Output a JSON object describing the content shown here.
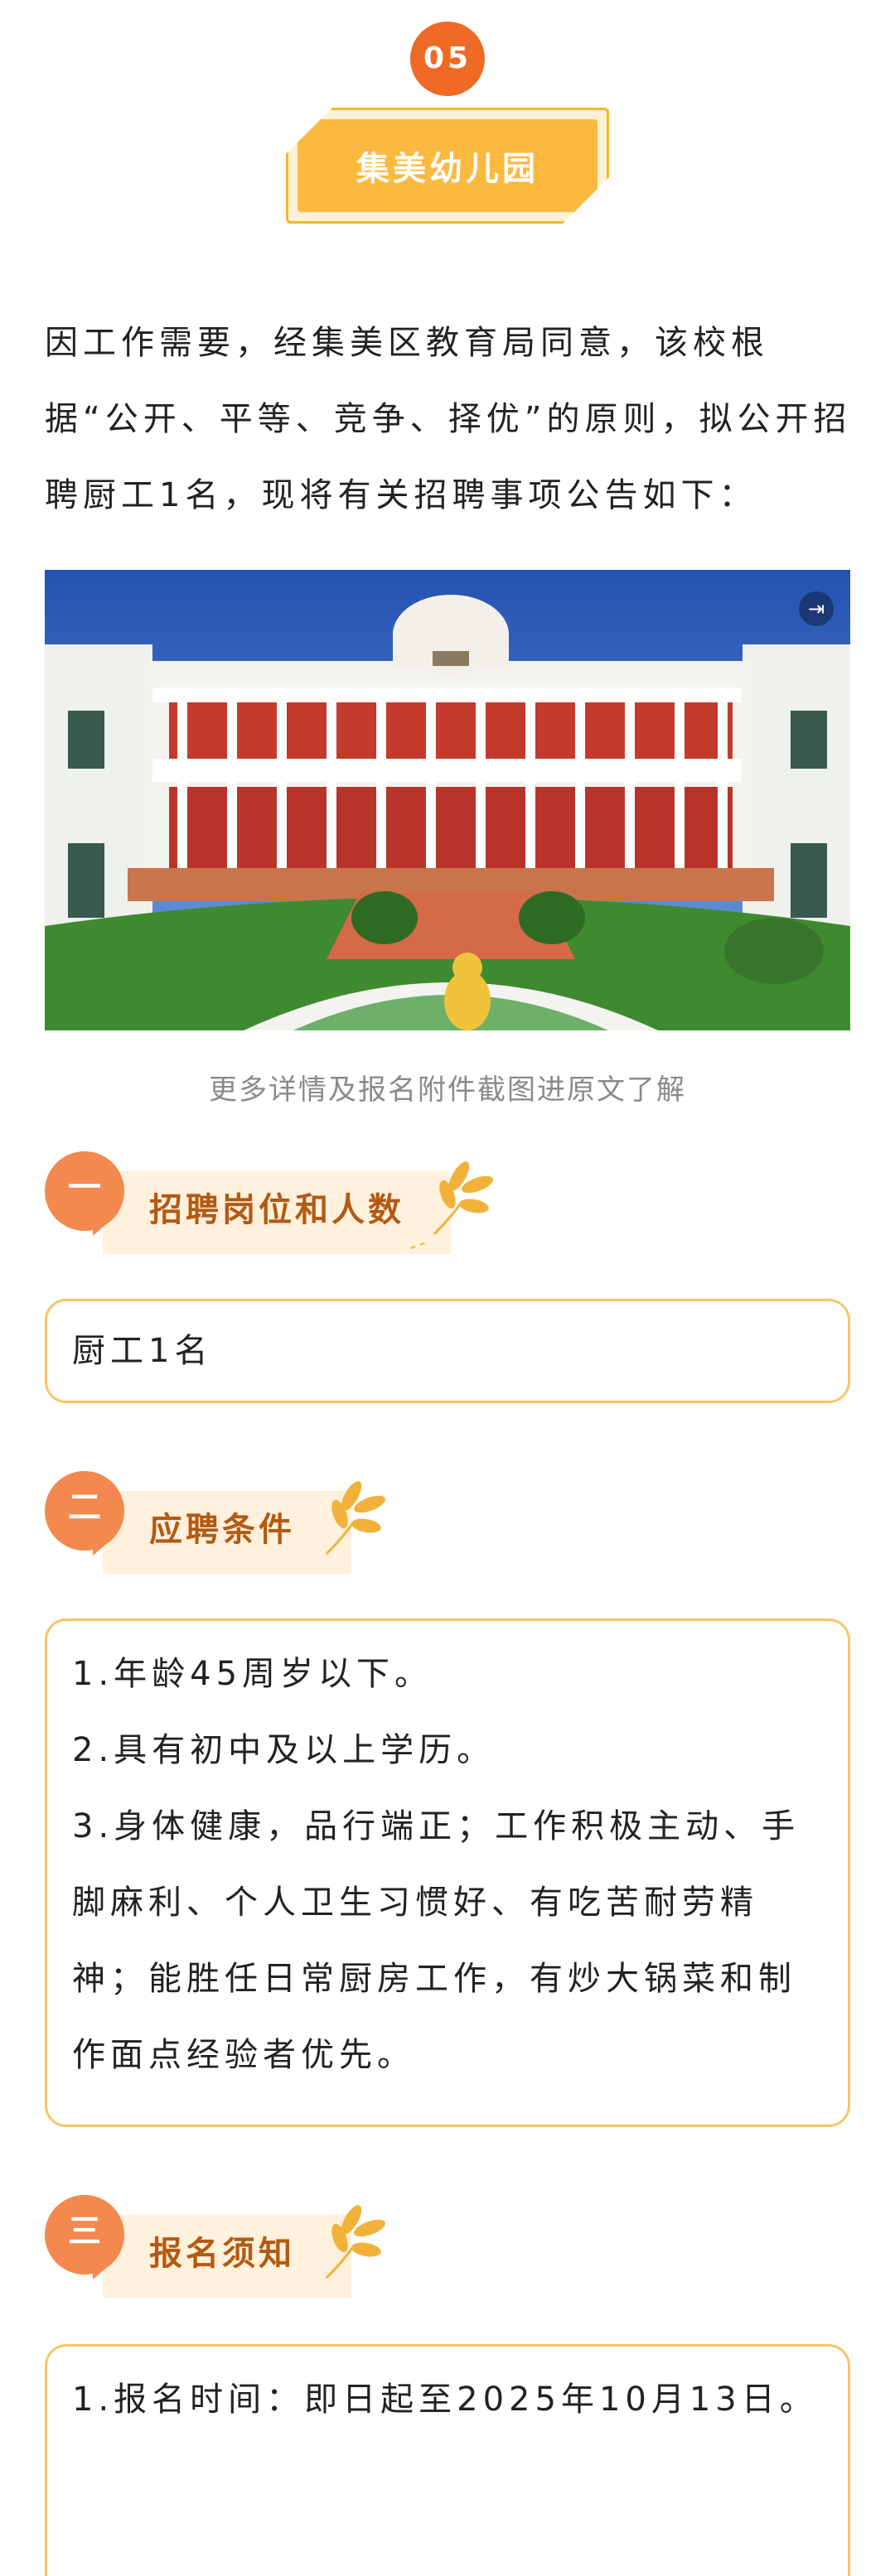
{
  "header": {
    "number": "05",
    "title": "集美幼儿园"
  },
  "intro": "因工作需要，经集美区教育局同意，该校根据“公开、平等、竞争、择优”的原则，拟公开招聘厨工1名，现将有关招聘事项公告如下：",
  "photo": {
    "caption": "更多详情及报名附件截图进原文了解",
    "icon": "expand-icon"
  },
  "sections": [
    {
      "number": "一",
      "title": "招聘岗位和人数",
      "lines": [
        "厨工1名"
      ]
    },
    {
      "number": "二",
      "title": "应聘条件",
      "lines": [
        "1.年龄45周岁以下。",
        "2.具有初中及以上学历。",
        "3.身体健康，品行端正；工作积极主动、手脚麻利、个人卫生习惯好、有吃苦耐劳精神；能胜任日常厨房工作，有炒大锅菜和制作面点经验者优先。"
      ]
    },
    {
      "number": "三",
      "title": "报名须知",
      "lines": [
        "1.报名时间：即日起至2025年10月13日。"
      ]
    }
  ],
  "colors": {
    "accent_orange": "#ef6a24",
    "title_yellow": "#fbb940",
    "section_brown": "#b25a14",
    "box_border": "#f5c668"
  }
}
